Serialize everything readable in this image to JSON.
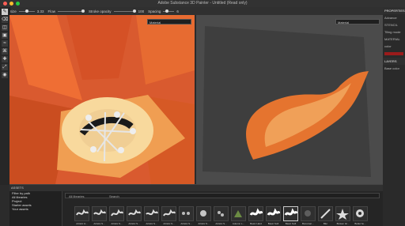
{
  "app": {
    "title": "Adobe Substance 3D Painter - Untitled (Read only)"
  },
  "toolbar": {
    "size_label": "Size",
    "size_value": "3.33",
    "flow_label": "Flow",
    "stroke_opacity_label": "Stroke opacity",
    "stroke_opacity_value": "100",
    "spacing_label": "Spacing",
    "spacing_value": "6"
  },
  "viewport_3d": {
    "material_label": "Material"
  },
  "viewport_2d": {
    "material_label": "Material"
  },
  "right_panel": {
    "properties_title": "PROPERTIES",
    "advanced_label": "Advance",
    "stencil_label": "STENCIL",
    "tiling_label": "Tiling mode",
    "material_label": "MATERIAL",
    "color_label": "color",
    "layers_title": "LAYERS",
    "base_color_label": "Base color"
  },
  "assets": {
    "title": "ASSETS",
    "filter_placeholder": "Filter by path",
    "all_libraries": "All libraries",
    "sidebar_items": [
      "All libraries",
      "Project",
      "Starter assets",
      "Your assets"
    ],
    "search_placeholder": "Search",
    "thumbnails": [
      "Artistic H...",
      "Artistic S...",
      "Artistic S...",
      "Artistic S...",
      "Artistic S...",
      "Artistic S...",
      "Artistic S...",
      "Artistic S...",
      "Artistic S...",
      "Autumn L...",
      "Basic Hard",
      "Basic Soft",
      "Basic Soft",
      "Bonsmal ...",
      "Blur",
      "Broken Gl...",
      "Bullet ho..."
    ]
  },
  "colors": {
    "accent_orange": "#cf4b1f",
    "ui_bg": "#2b2b2b",
    "panel": "#252525"
  }
}
